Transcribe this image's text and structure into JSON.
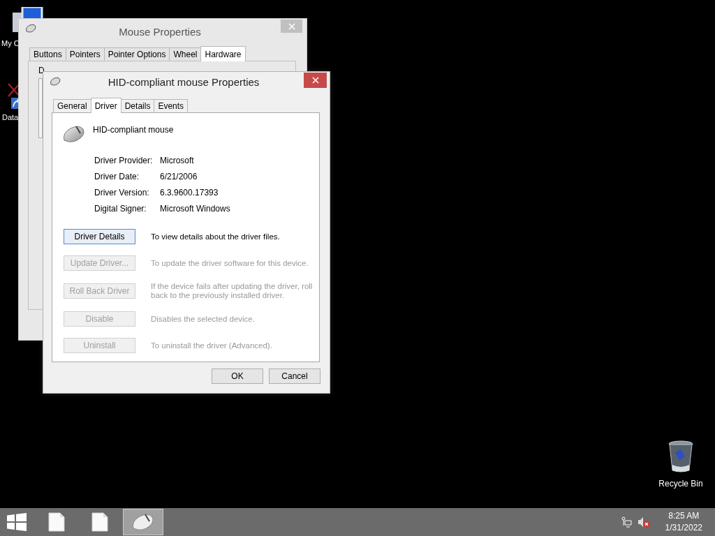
{
  "desktop_icons": [
    {
      "kind": "computer",
      "label": "My C"
    },
    {
      "kind": "shortcut",
      "label": "Data"
    },
    {
      "kind": "recycle",
      "label": "Recycle Bin"
    }
  ],
  "back_window": {
    "title": "Mouse Properties",
    "active": false,
    "tabs": [
      {
        "label": "Buttons",
        "selected": false
      },
      {
        "label": "Pointers",
        "selected": false
      },
      {
        "label": "Pointer Options",
        "selected": false
      },
      {
        "label": "Wheel",
        "selected": false
      },
      {
        "label": "Hardware",
        "selected": true
      }
    ],
    "partial_label": "D"
  },
  "dialog": {
    "title": "HID-compliant mouse Properties",
    "active": true,
    "tabs": [
      {
        "label": "General",
        "selected": false
      },
      {
        "label": "Driver",
        "selected": true
      },
      {
        "label": "Details",
        "selected": false
      },
      {
        "label": "Events",
        "selected": false
      }
    ],
    "device_name": "HID-compliant mouse",
    "properties": [
      {
        "label": "Driver Provider:",
        "value": "Microsoft"
      },
      {
        "label": "Driver Date:",
        "value": "6/21/2006"
      },
      {
        "label": "Driver Version:",
        "value": "6.3.9600.17393"
      },
      {
        "label": "Digital Signer:",
        "value": "Microsoft Windows"
      }
    ],
    "actions": [
      {
        "button": "Driver Details",
        "description": "To view details about the driver files.",
        "disabled": false,
        "focused": true
      },
      {
        "button": "Update Driver...",
        "description": "To update the driver software for this device.",
        "disabled": true,
        "focused": false
      },
      {
        "button": "Roll Back Driver",
        "description": "If the device fails after updating the driver, roll back to the previously installed driver.",
        "disabled": true,
        "focused": false
      },
      {
        "button": "Disable",
        "description": "Disables the selected device.",
        "disabled": true,
        "focused": false
      },
      {
        "button": "Uninstall",
        "description": "To uninstall the driver (Advanced).",
        "disabled": true,
        "focused": false
      }
    ],
    "buttons": [
      "OK",
      "Cancel"
    ]
  },
  "taskbar": {
    "items": [
      {
        "kind": "start",
        "selected": false
      },
      {
        "kind": "document",
        "selected": false
      },
      {
        "kind": "document",
        "selected": false
      },
      {
        "kind": "mouse",
        "selected": true
      }
    ],
    "tray": {
      "volume_muted": true,
      "time": "8:25 AM",
      "date": "1/31/2022"
    }
  }
}
